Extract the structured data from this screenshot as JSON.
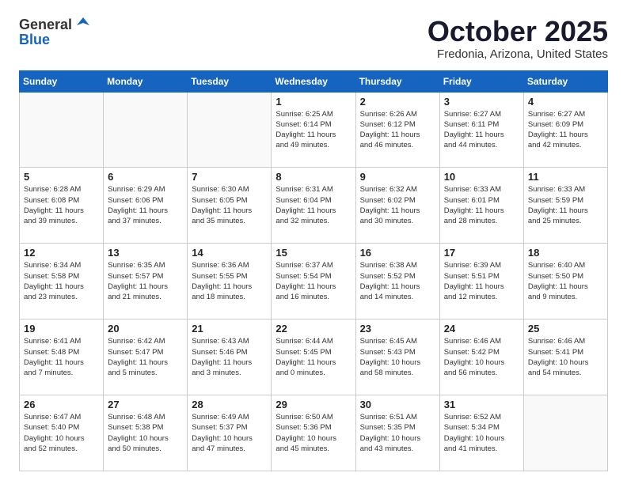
{
  "header": {
    "logo_line1": "General",
    "logo_line2": "Blue",
    "month": "October 2025",
    "location": "Fredonia, Arizona, United States"
  },
  "weekdays": [
    "Sunday",
    "Monday",
    "Tuesday",
    "Wednesday",
    "Thursday",
    "Friday",
    "Saturday"
  ],
  "weeks": [
    [
      {
        "day": "",
        "info": ""
      },
      {
        "day": "",
        "info": ""
      },
      {
        "day": "",
        "info": ""
      },
      {
        "day": "1",
        "info": "Sunrise: 6:25 AM\nSunset: 6:14 PM\nDaylight: 11 hours\nand 49 minutes."
      },
      {
        "day": "2",
        "info": "Sunrise: 6:26 AM\nSunset: 6:12 PM\nDaylight: 11 hours\nand 46 minutes."
      },
      {
        "day": "3",
        "info": "Sunrise: 6:27 AM\nSunset: 6:11 PM\nDaylight: 11 hours\nand 44 minutes."
      },
      {
        "day": "4",
        "info": "Sunrise: 6:27 AM\nSunset: 6:09 PM\nDaylight: 11 hours\nand 42 minutes."
      }
    ],
    [
      {
        "day": "5",
        "info": "Sunrise: 6:28 AM\nSunset: 6:08 PM\nDaylight: 11 hours\nand 39 minutes."
      },
      {
        "day": "6",
        "info": "Sunrise: 6:29 AM\nSunset: 6:06 PM\nDaylight: 11 hours\nand 37 minutes."
      },
      {
        "day": "7",
        "info": "Sunrise: 6:30 AM\nSunset: 6:05 PM\nDaylight: 11 hours\nand 35 minutes."
      },
      {
        "day": "8",
        "info": "Sunrise: 6:31 AM\nSunset: 6:04 PM\nDaylight: 11 hours\nand 32 minutes."
      },
      {
        "day": "9",
        "info": "Sunrise: 6:32 AM\nSunset: 6:02 PM\nDaylight: 11 hours\nand 30 minutes."
      },
      {
        "day": "10",
        "info": "Sunrise: 6:33 AM\nSunset: 6:01 PM\nDaylight: 11 hours\nand 28 minutes."
      },
      {
        "day": "11",
        "info": "Sunrise: 6:33 AM\nSunset: 5:59 PM\nDaylight: 11 hours\nand 25 minutes."
      }
    ],
    [
      {
        "day": "12",
        "info": "Sunrise: 6:34 AM\nSunset: 5:58 PM\nDaylight: 11 hours\nand 23 minutes."
      },
      {
        "day": "13",
        "info": "Sunrise: 6:35 AM\nSunset: 5:57 PM\nDaylight: 11 hours\nand 21 minutes."
      },
      {
        "day": "14",
        "info": "Sunrise: 6:36 AM\nSunset: 5:55 PM\nDaylight: 11 hours\nand 18 minutes."
      },
      {
        "day": "15",
        "info": "Sunrise: 6:37 AM\nSunset: 5:54 PM\nDaylight: 11 hours\nand 16 minutes."
      },
      {
        "day": "16",
        "info": "Sunrise: 6:38 AM\nSunset: 5:52 PM\nDaylight: 11 hours\nand 14 minutes."
      },
      {
        "day": "17",
        "info": "Sunrise: 6:39 AM\nSunset: 5:51 PM\nDaylight: 11 hours\nand 12 minutes."
      },
      {
        "day": "18",
        "info": "Sunrise: 6:40 AM\nSunset: 5:50 PM\nDaylight: 11 hours\nand 9 minutes."
      }
    ],
    [
      {
        "day": "19",
        "info": "Sunrise: 6:41 AM\nSunset: 5:48 PM\nDaylight: 11 hours\nand 7 minutes."
      },
      {
        "day": "20",
        "info": "Sunrise: 6:42 AM\nSunset: 5:47 PM\nDaylight: 11 hours\nand 5 minutes."
      },
      {
        "day": "21",
        "info": "Sunrise: 6:43 AM\nSunset: 5:46 PM\nDaylight: 11 hours\nand 3 minutes."
      },
      {
        "day": "22",
        "info": "Sunrise: 6:44 AM\nSunset: 5:45 PM\nDaylight: 11 hours\nand 0 minutes."
      },
      {
        "day": "23",
        "info": "Sunrise: 6:45 AM\nSunset: 5:43 PM\nDaylight: 10 hours\nand 58 minutes."
      },
      {
        "day": "24",
        "info": "Sunrise: 6:46 AM\nSunset: 5:42 PM\nDaylight: 10 hours\nand 56 minutes."
      },
      {
        "day": "25",
        "info": "Sunrise: 6:46 AM\nSunset: 5:41 PM\nDaylight: 10 hours\nand 54 minutes."
      }
    ],
    [
      {
        "day": "26",
        "info": "Sunrise: 6:47 AM\nSunset: 5:40 PM\nDaylight: 10 hours\nand 52 minutes."
      },
      {
        "day": "27",
        "info": "Sunrise: 6:48 AM\nSunset: 5:38 PM\nDaylight: 10 hours\nand 50 minutes."
      },
      {
        "day": "28",
        "info": "Sunrise: 6:49 AM\nSunset: 5:37 PM\nDaylight: 10 hours\nand 47 minutes."
      },
      {
        "day": "29",
        "info": "Sunrise: 6:50 AM\nSunset: 5:36 PM\nDaylight: 10 hours\nand 45 minutes."
      },
      {
        "day": "30",
        "info": "Sunrise: 6:51 AM\nSunset: 5:35 PM\nDaylight: 10 hours\nand 43 minutes."
      },
      {
        "day": "31",
        "info": "Sunrise: 6:52 AM\nSunset: 5:34 PM\nDaylight: 10 hours\nand 41 minutes."
      },
      {
        "day": "",
        "info": ""
      }
    ]
  ]
}
